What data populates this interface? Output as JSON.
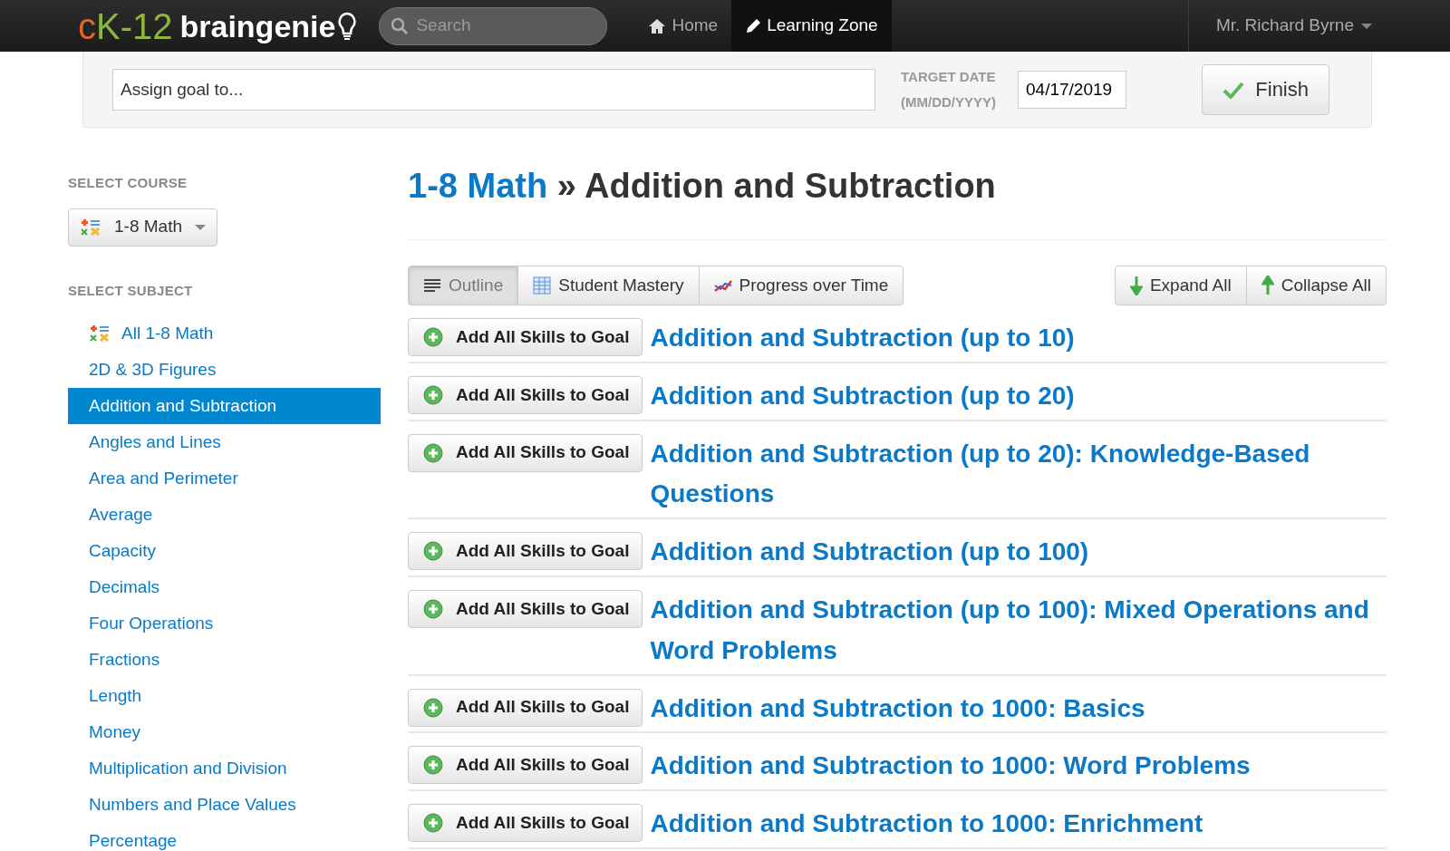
{
  "navbar": {
    "logo": {
      "prefix_c": "c",
      "prefix_rest": "K-12",
      "name": "braingenie"
    },
    "search": {
      "placeholder": "Search"
    },
    "links": [
      {
        "label": "Home",
        "kind": "home",
        "selected": false
      },
      {
        "label": "Learning Zone",
        "kind": "edit",
        "selected": true
      }
    ],
    "user": "Mr. Richard Byrne"
  },
  "assign_bar": {
    "assign_field": {
      "placeholder": "Assign goal to..."
    },
    "date_label": "TARGET DATE",
    "date_format": "(MM/DD/YYYY)",
    "date_value": "04/17/2019",
    "finish_button": "Finish"
  },
  "sidebar": {
    "course_heading": "SELECT COURSE",
    "course": "1-8 Math",
    "subject_heading": "SELECT SUBJECT",
    "subjects": [
      {
        "label": "All 1-8 Math",
        "kind": "all",
        "selected": false
      },
      {
        "label": "2D & 3D Figures",
        "kind": "subject",
        "selected": false
      },
      {
        "label": "Addition and Subtraction",
        "kind": "subject",
        "selected": true
      },
      {
        "label": "Angles and Lines",
        "kind": "subject",
        "selected": false
      },
      {
        "label": "Area and Perimeter",
        "kind": "subject",
        "selected": false
      },
      {
        "label": "Average",
        "kind": "subject",
        "selected": false
      },
      {
        "label": "Capacity",
        "kind": "subject",
        "selected": false
      },
      {
        "label": "Decimals",
        "kind": "subject",
        "selected": false
      },
      {
        "label": "Four Operations",
        "kind": "subject",
        "selected": false
      },
      {
        "label": "Fractions",
        "kind": "subject",
        "selected": false
      },
      {
        "label": "Length",
        "kind": "subject",
        "selected": false
      },
      {
        "label": "Money",
        "kind": "subject",
        "selected": false
      },
      {
        "label": "Multiplication and Division",
        "kind": "subject",
        "selected": false
      },
      {
        "label": "Numbers and Place Values",
        "kind": "subject",
        "selected": false
      },
      {
        "label": "Percentage",
        "kind": "subject",
        "selected": false
      }
    ]
  },
  "main": {
    "breadcrumb": {
      "course": "1-8 Math",
      "separator": "»",
      "subject": "Addition and Subtraction"
    },
    "view_tabs": [
      {
        "label": "Outline",
        "kind": "outline",
        "selected": true
      },
      {
        "label": "Student Mastery",
        "kind": "mastery",
        "selected": false
      },
      {
        "label": "Progress over Time",
        "kind": "progress",
        "selected": false
      }
    ],
    "expand_button": "Expand All",
    "collapse_button": "Collapse All",
    "topics": [
      {
        "add_button": "Add All Skills to Goal",
        "title": "Addition and Subtraction (up to 10)"
      },
      {
        "add_button": "Add All Skills to Goal",
        "title": "Addition and Subtraction (up to 20)"
      },
      {
        "add_button": "Add All Skills to Goal",
        "title": "Addition and Subtraction (up to 20): Knowledge-Based Questions"
      },
      {
        "add_button": "Add All Skills to Goal",
        "title": "Addition and Subtraction (up to 100)"
      },
      {
        "add_button": "Add All Skills to Goal",
        "title": "Addition and Subtraction (up to 100): Mixed Operations and Word Problems"
      },
      {
        "add_button": "Add All Skills to Goal",
        "title": "Addition and Subtraction to 1000: Basics"
      },
      {
        "add_button": "Add All Skills to Goal",
        "title": "Addition and Subtraction to 1000: Word Problems"
      },
      {
        "add_button": "Add All Skills to Goal",
        "title": "Addition and Subtraction to 1000: Enrichment"
      }
    ]
  }
}
